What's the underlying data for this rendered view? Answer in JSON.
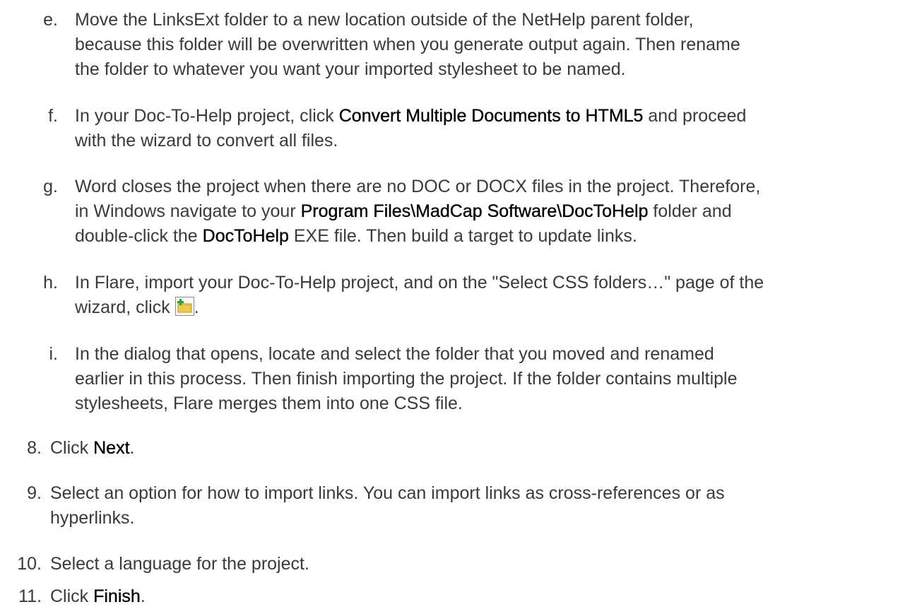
{
  "steps": {
    "e": {
      "marker": "e.",
      "lines": [
        "Move the LinksExt folder to a new location outside of the NetHelp parent folder,",
        "because this folder will be overwritten when you generate output again. Then rename",
        "the folder to whatever you want your imported stylesheet to be named."
      ]
    },
    "f": {
      "marker": "f.",
      "line1_pre": "In your Doc-To-Help project, click ",
      "line1_bold": "Convert Multiple Documents to HTML5",
      "line1_post": " and proceed",
      "line2": "with the wizard to convert all files."
    },
    "g": {
      "marker": "g.",
      "line1": "Word closes the project when there are no DOC or DOCX files in the project. Therefore,",
      "line2_pre": "in Windows navigate to your ",
      "line2_bold": "Program Files\\MadCap Software\\DocToHelp",
      "line2_post": " folder and",
      "line3_pre": "double-click the ",
      "line3_bold": "DocToHelp",
      "line3_post": " EXE file. Then build a target to update links."
    },
    "h": {
      "marker": "h.",
      "line1": "In Flare, import your Doc-To-Help project, and on the \"Select CSS folders…\" page of the",
      "line2_pre": "wizard, click ",
      "line2_post": ".",
      "icon": "add-folder-icon"
    },
    "i": {
      "marker": "i.",
      "lines": [
        "In the dialog that opens, locate and select the folder that you moved and renamed",
        "earlier in this process. Then finish importing the project. If the folder contains multiple",
        "stylesheets, Flare merges them into one CSS file."
      ]
    },
    "s8": {
      "marker": "8.",
      "pre": "Click ",
      "bold": "Next",
      "post": "."
    },
    "s9": {
      "marker": "9.",
      "lines": [
        "Select an option for how to import links. You can import links as cross-references or as",
        "hyperlinks."
      ]
    },
    "s10": {
      "marker": "10.",
      "text": "Select a language for the project."
    },
    "s11": {
      "marker": "11.",
      "pre": "Click ",
      "bold": "Finish",
      "post": "."
    }
  },
  "colors": {
    "text": "#3a3a3a",
    "bold": "#000000",
    "folder": "#f2c94c",
    "plus": "#2e9e2e"
  }
}
